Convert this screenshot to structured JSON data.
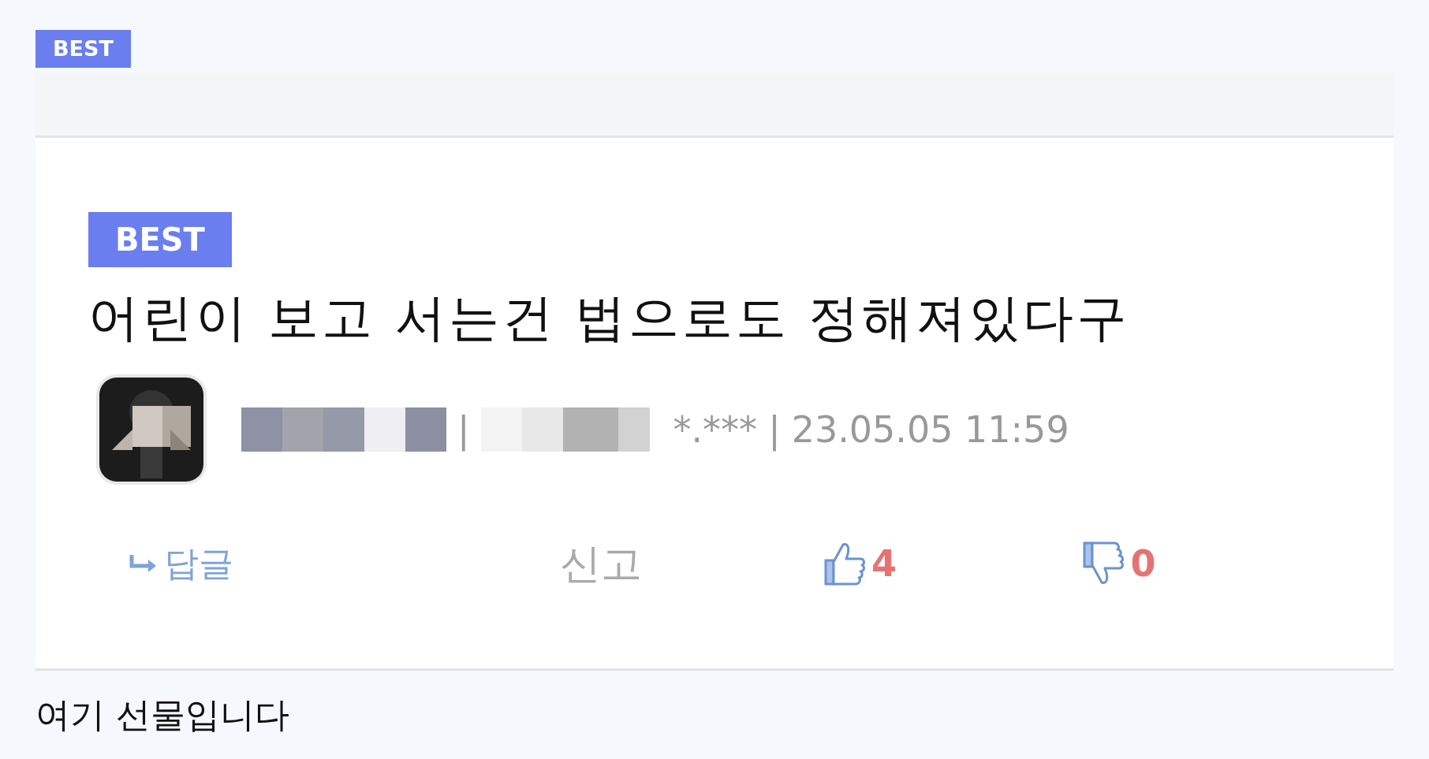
{
  "top_badge": "BEST",
  "comment": {
    "badge": "BEST",
    "text": "어린이 보고 서는건 법으로도 정해져있다구",
    "ip": "*.***",
    "separator": "|",
    "date": "23.05.05 11:59",
    "actions": [
      {
        "kind": "reply",
        "label": "답글"
      },
      {
        "kind": "report",
        "label": "신고"
      },
      {
        "kind": "like",
        "label": "4"
      },
      {
        "kind": "dislike",
        "label": "0"
      }
    ]
  },
  "footer_text": "여기 선물입니다"
}
